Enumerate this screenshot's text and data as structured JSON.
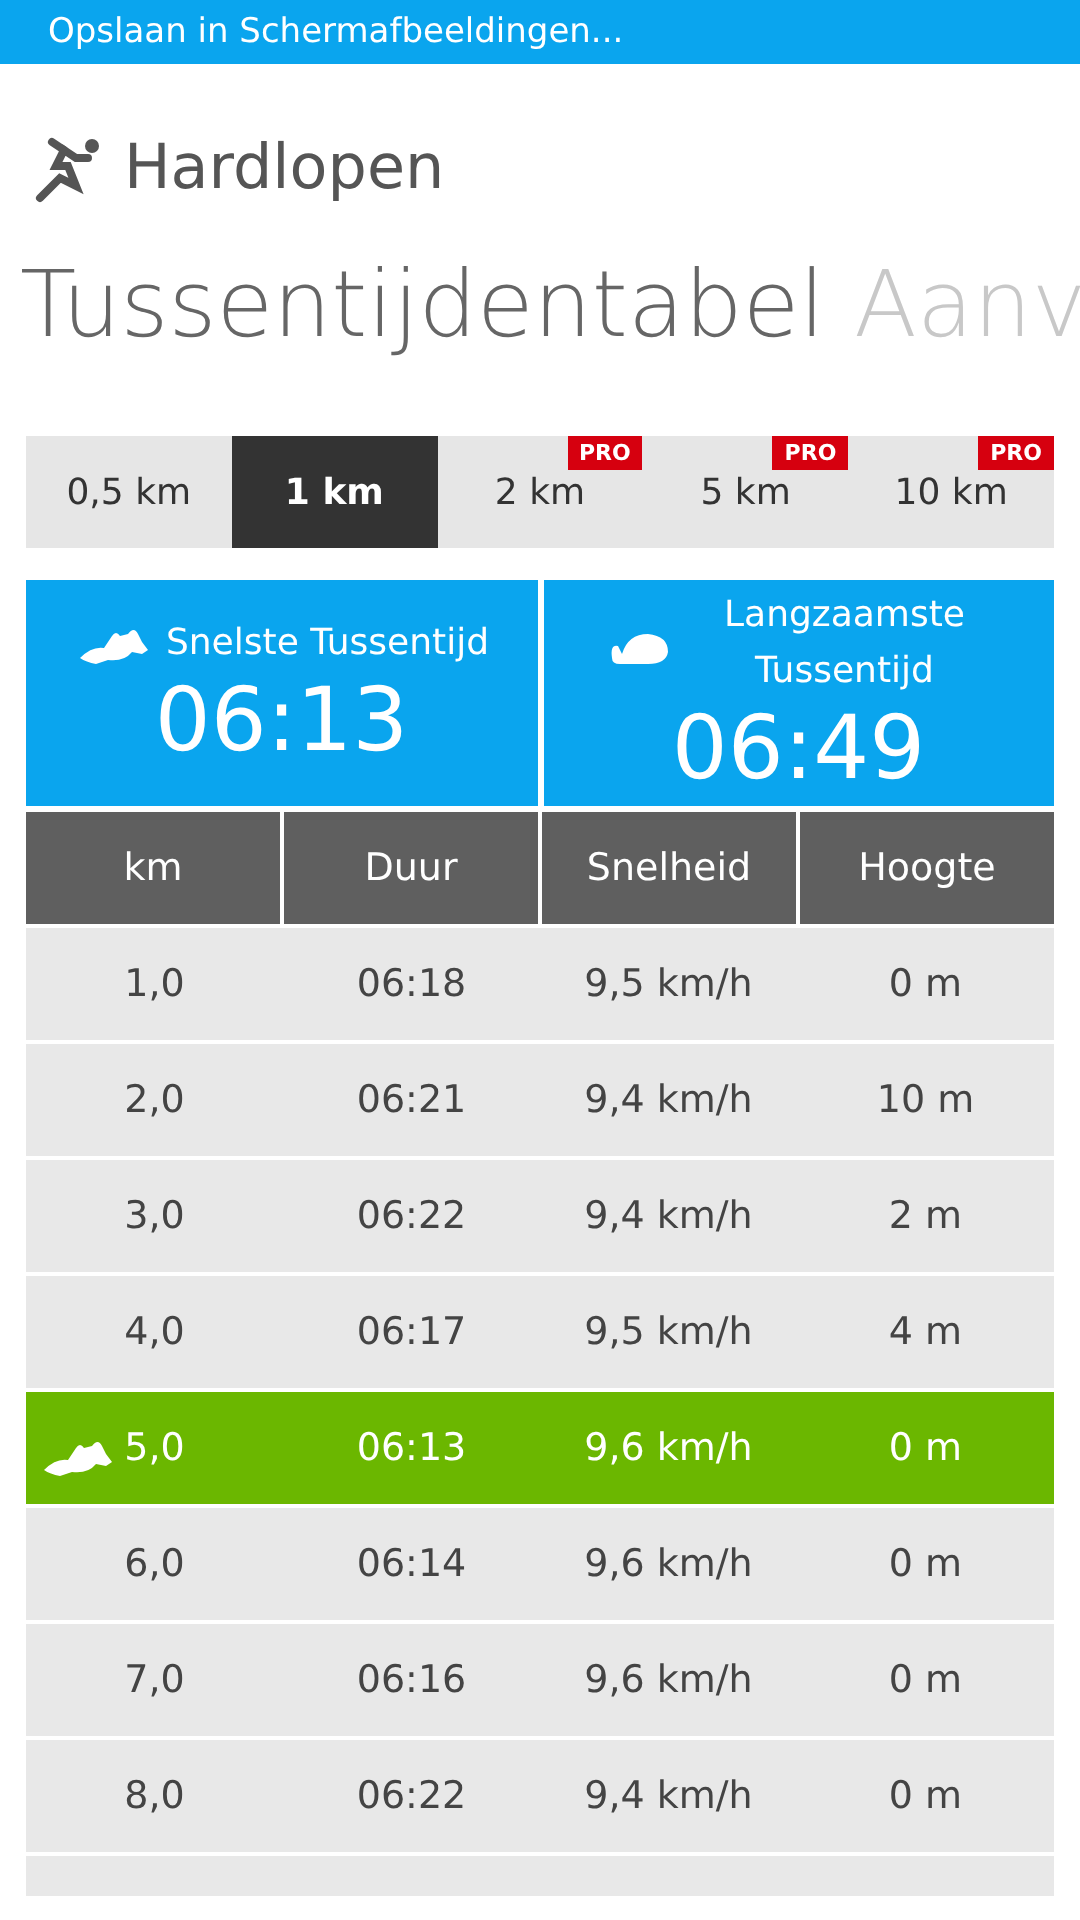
{
  "status_bar": {
    "text": "Opslaan in Schermafbeeldingen..."
  },
  "app": {
    "title": "Hardlopen"
  },
  "pivot": [
    {
      "label": "Tussentijdentabel",
      "selected": true
    },
    {
      "label": "Aanv",
      "selected": false
    }
  ],
  "segments": [
    {
      "label": "0,5 km",
      "selected": false,
      "pro": false
    },
    {
      "label": "1 km",
      "selected": true,
      "pro": false
    },
    {
      "label": "2 km",
      "selected": false,
      "pro": true,
      "badge": "PRO"
    },
    {
      "label": "5 km",
      "selected": false,
      "pro": true,
      "badge": "PRO"
    },
    {
      "label": "10 km",
      "selected": false,
      "pro": true,
      "badge": "PRO"
    }
  ],
  "summary": [
    {
      "kind": "fastest",
      "label": "Snelste Tussentijd",
      "value": "06:13"
    },
    {
      "kind": "slowest",
      "label": "Langzaamste Tussentijd",
      "value": "06:49"
    }
  ],
  "table": {
    "columns": [
      "km",
      "Duur",
      "Snelheid",
      "Hoogte"
    ],
    "rows": [
      {
        "cells": [
          "1,0",
          "06:18",
          "9,5 km/h",
          "0 m"
        ],
        "fastest": false
      },
      {
        "cells": [
          "2,0",
          "06:21",
          "9,4 km/h",
          "10 m"
        ],
        "fastest": false
      },
      {
        "cells": [
          "3,0",
          "06:22",
          "9,4 km/h",
          "2 m"
        ],
        "fastest": false
      },
      {
        "cells": [
          "4,0",
          "06:17",
          "9,5 km/h",
          "4 m"
        ],
        "fastest": false
      },
      {
        "cells": [
          "5,0",
          "06:13",
          "9,6 km/h",
          "0 m"
        ],
        "fastest": true
      },
      {
        "cells": [
          "6,0",
          "06:14",
          "9,6 km/h",
          "0 m"
        ],
        "fastest": false
      },
      {
        "cells": [
          "7,0",
          "06:16",
          "9,6 km/h",
          "0 m"
        ],
        "fastest": false
      },
      {
        "cells": [
          "8,0",
          "06:22",
          "9,4 km/h",
          "0 m"
        ],
        "fastest": false
      }
    ]
  }
}
